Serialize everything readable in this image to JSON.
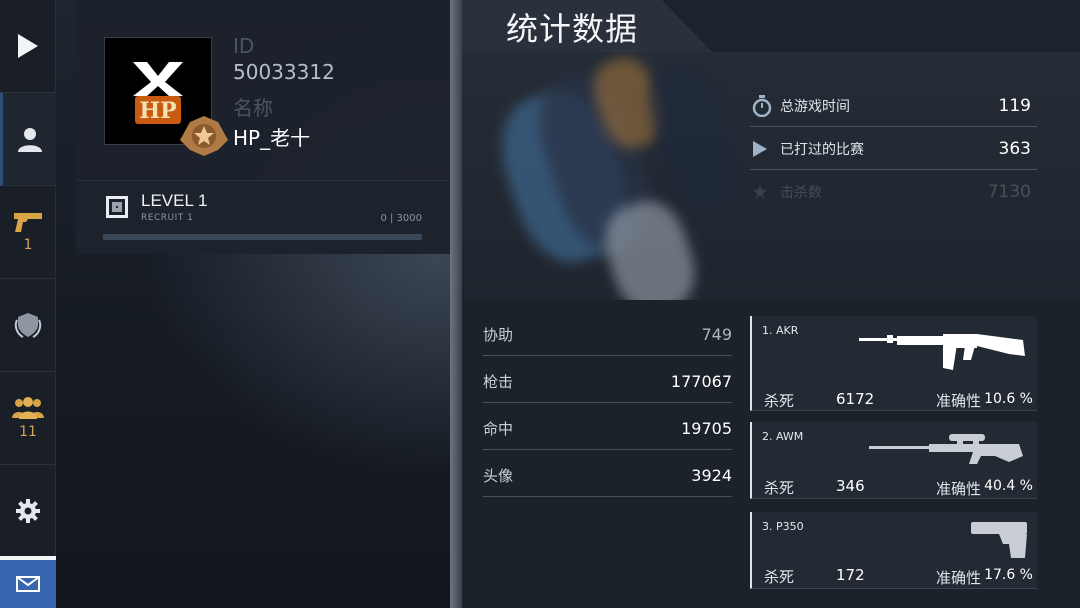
{
  "sidebar": {
    "items": [
      {
        "icon": "play-icon"
      },
      {
        "icon": "profile-icon"
      },
      {
        "icon": "pistol-icon",
        "count": "1"
      },
      {
        "icon": "shield-icon"
      },
      {
        "icon": "team-icon",
        "count": "11"
      },
      {
        "icon": "gear-icon"
      },
      {
        "icon": "mail-icon"
      }
    ],
    "colors": {
      "active_accent": "#2e4f78",
      "count": "#d2a455",
      "mail_bg": "#3766ae"
    }
  },
  "profile": {
    "avatar_text": "HP",
    "id_label": "ID",
    "id_value": "50033312",
    "name_label": "名称",
    "name_value": "HP_老十",
    "level_title": "LEVEL 1",
    "level_sub": "RECRUIT 1",
    "xp": "0 | 3000",
    "xp_fraction": 0
  },
  "stats": {
    "title": "统计数据",
    "top": [
      {
        "icon": "stopwatch-icon",
        "label": "总游戏时间",
        "value": "119"
      },
      {
        "icon": "play-icon",
        "label": "已打过的比赛",
        "value": "363"
      },
      {
        "icon": "star-icon",
        "label": "击杀数",
        "value": "7130"
      }
    ],
    "rows": [
      {
        "label": "协助",
        "value": "749"
      },
      {
        "label": "枪击",
        "value": "177067"
      },
      {
        "label": "命中",
        "value": "19705"
      },
      {
        "label": "头像",
        "value": "3924"
      }
    ]
  },
  "weapons": [
    {
      "name": "1. AKR",
      "kills_label": "杀死",
      "kills": "6172",
      "acc_label": "准确性",
      "accuracy": "10.6 %"
    },
    {
      "name": "2. AWM",
      "kills_label": "杀死",
      "kills": "346",
      "acc_label": "准确性",
      "accuracy": "40.4 %"
    },
    {
      "name": "3. P350",
      "kills_label": "杀死",
      "kills": "172",
      "acc_label": "准确性",
      "accuracy": "17.6 %"
    }
  ]
}
